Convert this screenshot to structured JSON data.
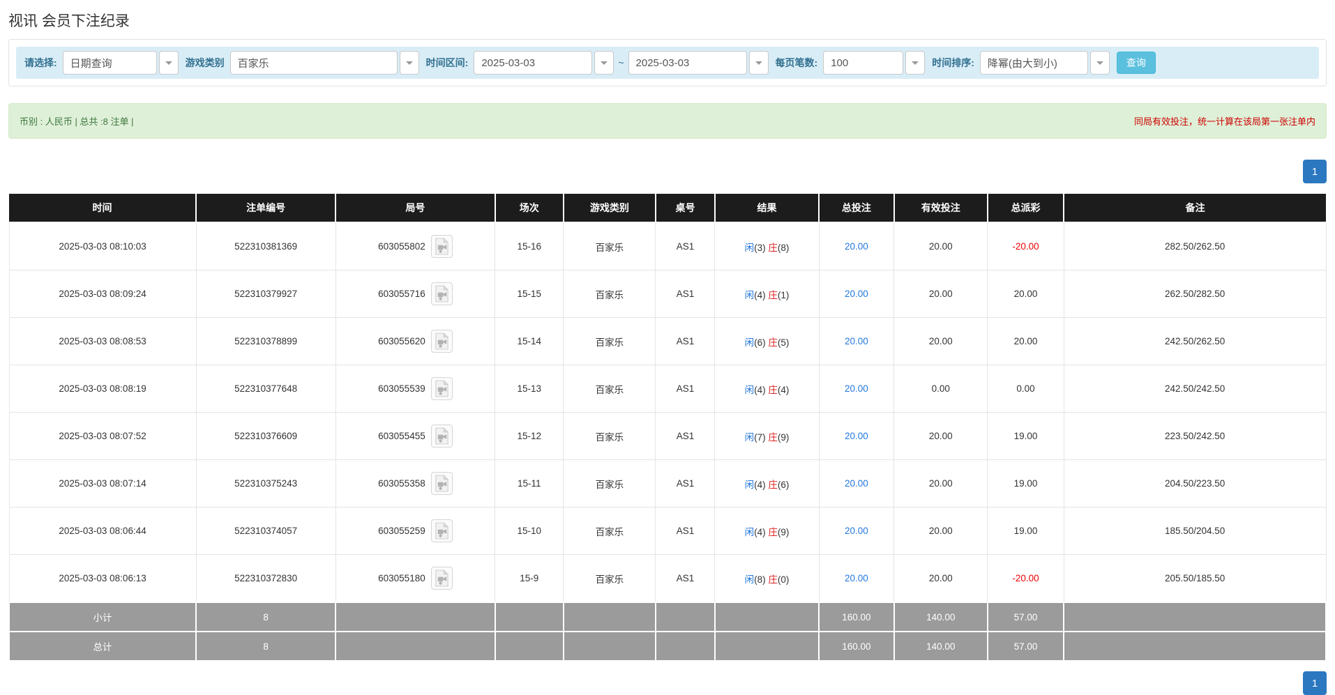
{
  "page": {
    "title": "视讯 会员下注纪录"
  },
  "filters": {
    "query_type_label": "请选择:",
    "query_type_value": "日期查询",
    "game_type_label": "游戏类别",
    "game_type_value": "百家乐",
    "date_range_label": "时间区间:",
    "date_from": "2025-03-03",
    "date_separator": "~",
    "date_to": "2025-03-03",
    "page_size_label": "每页笔数:",
    "page_size_value": "100",
    "sort_label": "时间排序:",
    "sort_value": "降幂(由大到小)",
    "search_button": "查询"
  },
  "summary": {
    "info": "币别 : 人民币 | 总共 :8 注单 |",
    "note": "同局有效投注，统一计算在该局第一张注单内"
  },
  "pagination": {
    "page": "1"
  },
  "colors": {
    "accent_blue": "#2b77c0",
    "player_blue": "#2277dd",
    "banker_red": "#dd2222",
    "negative_red": "#ee0000",
    "footer_gray": "#9b9b9b",
    "header_black": "#1c1c1c"
  },
  "icons": {
    "dropdown_arrow": "caret-down",
    "round_media": "video-file-icon"
  },
  "table": {
    "headers": [
      "时间",
      "注单编号",
      "局号",
      "场次",
      "游戏类别",
      "桌号",
      "结果",
      "总投注",
      "有效投注",
      "总派彩",
      "备注"
    ],
    "rows": [
      {
        "time": "2025-03-03 08:10:03",
        "bet_no": "522310381369",
        "round_no": "603055802",
        "session": "15-16",
        "game": "百家乐",
        "table_no": "AS1",
        "result_player": "闲(3)",
        "result_banker": "庄(8)",
        "total_bet": "20.00",
        "valid_bet": "20.00",
        "payout": "-20.00",
        "remark": "282.50/262.50"
      },
      {
        "time": "2025-03-03 08:09:24",
        "bet_no": "522310379927",
        "round_no": "603055716",
        "session": "15-15",
        "game": "百家乐",
        "table_no": "AS1",
        "result_player": "闲(4)",
        "result_banker": "庄(1)",
        "total_bet": "20.00",
        "valid_bet": "20.00",
        "payout": "20.00",
        "remark": "262.50/282.50"
      },
      {
        "time": "2025-03-03 08:08:53",
        "bet_no": "522310378899",
        "round_no": "603055620",
        "session": "15-14",
        "game": "百家乐",
        "table_no": "AS1",
        "result_player": "闲(6)",
        "result_banker": "庄(5)",
        "total_bet": "20.00",
        "valid_bet": "20.00",
        "payout": "20.00",
        "remark": "242.50/262.50"
      },
      {
        "time": "2025-03-03 08:08:19",
        "bet_no": "522310377648",
        "round_no": "603055539",
        "session": "15-13",
        "game": "百家乐",
        "table_no": "AS1",
        "result_player": "闲(4)",
        "result_banker": "庄(4)",
        "total_bet": "20.00",
        "valid_bet": "0.00",
        "payout": "0.00",
        "remark": "242.50/242.50"
      },
      {
        "time": "2025-03-03 08:07:52",
        "bet_no": "522310376609",
        "round_no": "603055455",
        "session": "15-12",
        "game": "百家乐",
        "table_no": "AS1",
        "result_player": "闲(7)",
        "result_banker": "庄(9)",
        "total_bet": "20.00",
        "valid_bet": "20.00",
        "payout": "19.00",
        "remark": "223.50/242.50"
      },
      {
        "time": "2025-03-03 08:07:14",
        "bet_no": "522310375243",
        "round_no": "603055358",
        "session": "15-11",
        "game": "百家乐",
        "table_no": "AS1",
        "result_player": "闲(4)",
        "result_banker": "庄(6)",
        "total_bet": "20.00",
        "valid_bet": "20.00",
        "payout": "19.00",
        "remark": "204.50/223.50"
      },
      {
        "time": "2025-03-03 08:06:44",
        "bet_no": "522310374057",
        "round_no": "603055259",
        "session": "15-10",
        "game": "百家乐",
        "table_no": "AS1",
        "result_player": "闲(4)",
        "result_banker": "庄(9)",
        "total_bet": "20.00",
        "valid_bet": "20.00",
        "payout": "19.00",
        "remark": "185.50/204.50"
      },
      {
        "time": "2025-03-03 08:06:13",
        "bet_no": "522310372830",
        "round_no": "603055180",
        "session": "15-9",
        "game": "百家乐",
        "table_no": "AS1",
        "result_player": "闲(8)",
        "result_banker": "庄(0)",
        "total_bet": "20.00",
        "valid_bet": "20.00",
        "payout": "-20.00",
        "remark": "205.50/185.50"
      }
    ],
    "subtotal": {
      "label": "小计",
      "count": "8",
      "total_bet": "160.00",
      "valid_bet": "140.00",
      "payout": "57.00"
    },
    "total": {
      "label": "总计",
      "count": "8",
      "total_bet": "160.00",
      "valid_bet": "140.00",
      "payout": "57.00"
    }
  }
}
